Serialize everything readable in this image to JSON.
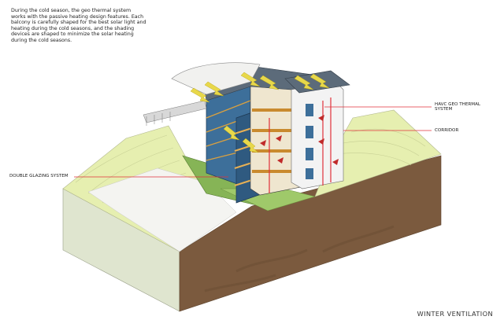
{
  "description": "During the cold season, the geo thermal system works with the passive heating design features. Each balcony is carefully shaped for the best solar light and heating during the cold seasons, and the shading devices are shaped to minimize the solar heating during the cold seasons.",
  "labels": {
    "hvac": "HAVC GEO THERMAL SYSTEM",
    "corridor": "CORRIDOR",
    "double_glazing": "DOUBLE GLAZING SYSTEM"
  },
  "title": "WINTER VENTILATION",
  "colors": {
    "annotation_line": "#e0303a",
    "soil": "#7b5a3e",
    "grass": "#e6efb0",
    "glass": "#3d6f9a",
    "roof": "#5c6b7a",
    "timber": "#d9a040",
    "heat_arrow": "#e8d84a",
    "air_arrow": "#c02a2a"
  }
}
